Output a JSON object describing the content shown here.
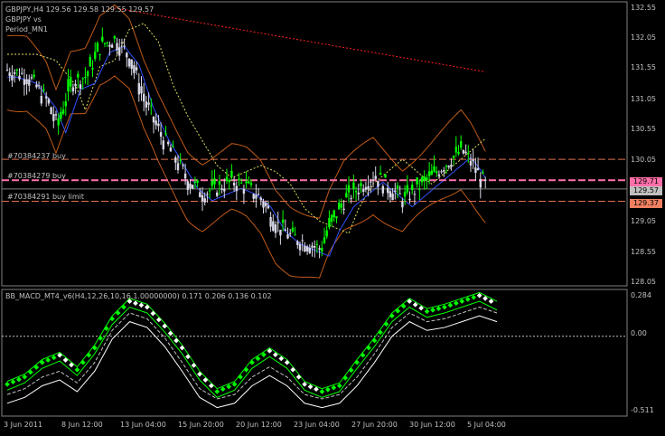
{
  "main_panel": {
    "symbol_line": "GBPJPY,H4  129.56 129.58 129.55 129.57",
    "indicator_line_1": "GBPJPY vs",
    "indicator_line_2": "Period_MN1",
    "orders": [
      {
        "label": "#70384237 buy",
        "price": 130.05
      },
      {
        "label": "#70384279 buy",
        "price": 129.71
      },
      {
        "label": "#70384291 buy limit",
        "price": 129.37
      }
    ],
    "price_ticks": [
      "132.55",
      "132.05",
      "131.55",
      "131.05",
      "130.55",
      "130.05",
      "129.55",
      "129.05",
      "128.55",
      "128.05"
    ],
    "price_range": [
      128.0,
      132.6
    ],
    "current_price_tag": "129.57",
    "order_tags": [
      {
        "text": "129.71",
        "color": "#ff6fa8"
      },
      {
        "text": "129.37",
        "color": "#f08060"
      }
    ]
  },
  "sub_panel": {
    "indicator_line": "BB_MACD_MT4_v6(H4,12,26,10,16,1.00000000) 0.171 0.206 0.136 0.102",
    "ticks": [
      "0.284",
      "0.00",
      "-0.511"
    ],
    "range": [
      -0.511,
      0.284
    ]
  },
  "time_axis": [
    "3 Jun 2011",
    "8 Jun 12:00",
    "13 Jun 04:00",
    "15 Jun 20:00",
    "20 Jun 12:00",
    "23 Jun 04:00",
    "27 Jun 20:00",
    "30 Jun 12:00",
    "5 Jul 04:00"
  ],
  "colors": {
    "bull": "#00ff00",
    "bear": "#d8d8e8",
    "bb_line": "#3050ff",
    "envelope": "#c05a18",
    "dotted_red": "#ff2020",
    "dotted_yellow": "#e0e060",
    "order_buy": "#e07050",
    "order_pink": "#ff6fa8",
    "macd_upper": "#00ff00",
    "macd_lower": "#ffffff"
  },
  "chart_data": [
    {
      "type": "candlestick",
      "title": "GBPJPY,H4",
      "ylim": [
        128.0,
        132.6
      ],
      "close_path": [
        {
          "x": 0,
          "close": 131.5
        },
        {
          "x": 8,
          "close": 131.4
        },
        {
          "x": 16,
          "close": 131.0
        },
        {
          "x": 20,
          "close": 130.6
        },
        {
          "x": 26,
          "close": 131.3
        },
        {
          "x": 32,
          "close": 131.4
        },
        {
          "x": 38,
          "close": 131.9
        },
        {
          "x": 44,
          "close": 132.0
        },
        {
          "x": 50,
          "close": 131.7
        },
        {
          "x": 56,
          "close": 131.0
        },
        {
          "x": 62,
          "close": 130.5
        },
        {
          "x": 68,
          "close": 130.1
        },
        {
          "x": 74,
          "close": 129.7
        },
        {
          "x": 80,
          "close": 129.5
        },
        {
          "x": 86,
          "close": 129.6
        },
        {
          "x": 92,
          "close": 129.7
        },
        {
          "x": 98,
          "close": 129.6
        },
        {
          "x": 104,
          "close": 129.4
        },
        {
          "x": 110,
          "close": 129.0
        },
        {
          "x": 116,
          "close": 128.8
        },
        {
          "x": 122,
          "close": 128.7
        },
        {
          "x": 128,
          "close": 128.6
        },
        {
          "x": 132,
          "close": 129.0
        },
        {
          "x": 138,
          "close": 129.4
        },
        {
          "x": 144,
          "close": 129.6
        },
        {
          "x": 150,
          "close": 129.8
        },
        {
          "x": 156,
          "close": 129.6
        },
        {
          "x": 162,
          "close": 129.4
        },
        {
          "x": 168,
          "close": 129.6
        },
        {
          "x": 174,
          "close": 129.8
        },
        {
          "x": 180,
          "close": 130.0
        },
        {
          "x": 186,
          "close": 130.2
        },
        {
          "x": 190,
          "close": 130.0
        },
        {
          "x": 196,
          "close": 129.6
        }
      ]
    },
    {
      "type": "line",
      "title": "BB_MACD_MT4_v6",
      "ylim": [
        -0.511,
        0.284
      ],
      "series": [
        {
          "values": [
            -0.35,
            -0.3,
            -0.2,
            -0.15,
            -0.25,
            -0.1,
            0.1,
            0.22,
            0.18,
            0.05,
            -0.1,
            -0.28,
            -0.4,
            -0.35,
            -0.2,
            -0.12,
            -0.2,
            -0.35,
            -0.4,
            -0.36,
            -0.2,
            -0.05,
            0.12,
            0.22,
            0.15,
            0.18,
            0.22,
            0.26,
            0.2
          ]
        },
        {
          "values": [
            -0.44,
            -0.4,
            -0.32,
            -0.28,
            -0.36,
            -0.22,
            0.0,
            0.12,
            0.08,
            -0.05,
            -0.22,
            -0.4,
            -0.47,
            -0.44,
            -0.32,
            -0.25,
            -0.32,
            -0.44,
            -0.47,
            -0.44,
            -0.32,
            -0.16,
            0.02,
            0.12,
            0.06,
            0.08,
            0.12,
            0.16,
            0.12
          ]
        }
      ]
    }
  ]
}
